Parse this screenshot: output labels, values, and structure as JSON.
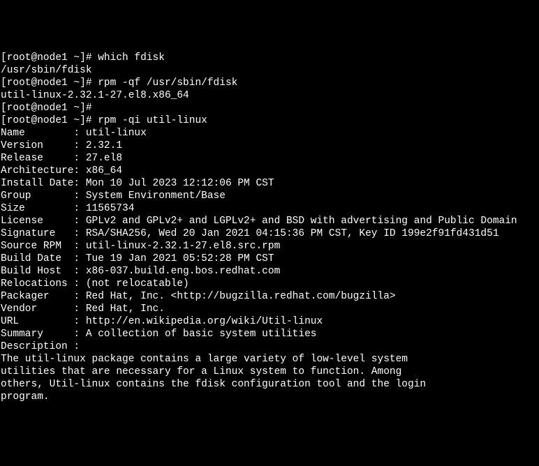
{
  "lines": [
    {
      "text": "[root@node1 ~]# which fdisk",
      "interactable": false
    },
    {
      "text": "/usr/sbin/fdisk",
      "interactable": false
    },
    {
      "text": "[root@node1 ~]# rpm -qf /usr/sbin/fdisk",
      "interactable": false
    },
    {
      "text": "util-linux-2.32.1-27.el8.x86_64",
      "interactable": false
    },
    {
      "text": "[root@node1 ~]#",
      "interactable": false
    },
    {
      "text": "[root@node1 ~]# rpm -qi util-linux",
      "interactable": false
    },
    {
      "text": "Name        : util-linux",
      "interactable": false
    },
    {
      "text": "Version     : 2.32.1",
      "interactable": false
    },
    {
      "text": "Release     : 27.el8",
      "interactable": false
    },
    {
      "text": "Architecture: x86_64",
      "interactable": false
    },
    {
      "text": "Install Date: Mon 10 Jul 2023 12:12:06 PM CST",
      "interactable": false
    },
    {
      "text": "Group       : System Environment/Base",
      "interactable": false
    },
    {
      "text": "Size        : 11565734",
      "interactable": false
    },
    {
      "text": "License     : GPLv2 and GPLv2+ and LGPLv2+ and BSD with advertising and Public Domain",
      "interactable": false
    },
    {
      "text": "Signature   : RSA/SHA256, Wed 20 Jan 2021 04:15:36 PM CST, Key ID 199e2f91fd431d51",
      "interactable": false
    },
    {
      "text": "Source RPM  : util-linux-2.32.1-27.el8.src.rpm",
      "interactable": false
    },
    {
      "text": "Build Date  : Tue 19 Jan 2021 05:52:28 PM CST",
      "interactable": false
    },
    {
      "text": "Build Host  : x86-037.build.eng.bos.redhat.com",
      "interactable": false
    },
    {
      "text": "Relocations : (not relocatable)",
      "interactable": false
    },
    {
      "text": "Packager    : Red Hat, Inc. <http://bugzilla.redhat.com/bugzilla>",
      "interactable": false
    },
    {
      "text": "Vendor      : Red Hat, Inc.",
      "interactable": false
    },
    {
      "text": "URL         : http://en.wikipedia.org/wiki/Util-linux",
      "interactable": false
    },
    {
      "text": "Summary     : A collection of basic system utilities",
      "interactable": false
    },
    {
      "text": "Description :",
      "interactable": false
    },
    {
      "text": "The util-linux package contains a large variety of low-level system",
      "interactable": false
    },
    {
      "text": "utilities that are necessary for a Linux system to function. Among",
      "interactable": false
    },
    {
      "text": "others, Util-linux contains the fdisk configuration tool and the login",
      "interactable": false
    },
    {
      "text": "program.",
      "interactable": false
    }
  ],
  "prompt": "[root@node1 ~]#",
  "commands": {
    "cmd1": "which fdisk",
    "cmd2": "rpm -qf /usr/sbin/fdisk",
    "cmd3": "rpm -qi util-linux"
  },
  "package_info": {
    "name": "util-linux",
    "version": "2.32.1",
    "release": "27.el8",
    "architecture": "x86_64",
    "install_date": "Mon 10 Jul 2023 12:12:06 PM CST",
    "group": "System Environment/Base",
    "size": "11565734",
    "license": "GPLv2 and GPLv2+ and LGPLv2+ and BSD with advertising and Public Domain",
    "signature": "RSA/SHA256, Wed 20 Jan 2021 04:15:36 PM CST, Key ID 199e2f91fd431d51",
    "source_rpm": "util-linux-2.32.1-27.el8.src.rpm",
    "build_date": "Tue 19 Jan 2021 05:52:28 PM CST",
    "build_host": "x86-037.build.eng.bos.redhat.com",
    "relocations": "(not relocatable)",
    "packager": "Red Hat, Inc. <http://bugzilla.redhat.com/bugzilla>",
    "vendor": "Red Hat, Inc.",
    "url": "http://en.wikipedia.org/wiki/Util-linux",
    "summary": "A collection of basic system utilities"
  }
}
